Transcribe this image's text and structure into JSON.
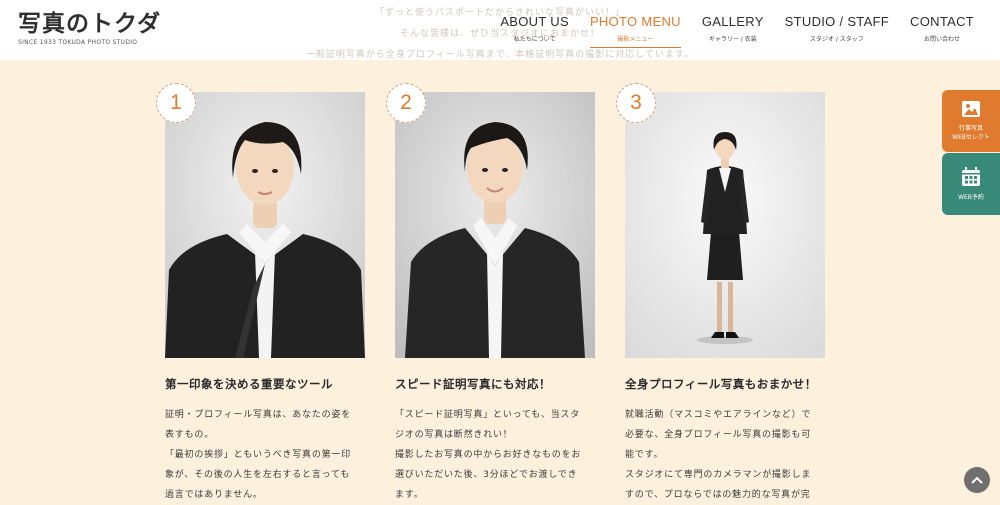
{
  "header": {
    "background_lines": [
      "「ずっと使うパスポートだからきれいな写真がいい！」",
      "そんな皆様は、ぜひ当スタジオにおまかせ！",
      "一般証明写真から全身プロフィール写真まで、本格証明写真の撮影に対応しています。"
    ],
    "logo": {
      "main": "写真のトクダ",
      "sub": "SINCE 1933 TOKUDA PHOTO STUDIO"
    }
  },
  "nav": {
    "items": [
      {
        "en": "ABOUT US",
        "jp": "私たちについて"
      },
      {
        "en": "PHOTO MENU",
        "jp": "撮影メニュー"
      },
      {
        "en": "GALLERY",
        "jp": "ギャラリー / 衣装"
      },
      {
        "en": "STUDIO / STAFF",
        "jp": "スタジオ / スタッフ"
      },
      {
        "en": "CONTACT",
        "jp": "お問い合わせ"
      }
    ],
    "active_index": 1
  },
  "cards": [
    {
      "num": "1",
      "title": "第一印象を決める重要なツール",
      "lines": [
        "証明・プロフィール写真は、あなたの姿を",
        "表すもの。",
        "「最初の挨拶」ともいうべき写真の第一印",
        "象が、その後の人生を左右すると言っても",
        "過言ではありません。"
      ]
    },
    {
      "num": "2",
      "title": "スピード証明写真にも対応！",
      "lines": [
        "「スピード証明写真」といっても、当スタ",
        "ジオの写真は断然きれい！",
        "撮影したお写真の中からお好きなものをお",
        "選びいただいた後、3分ほどでお渡しでき",
        "ます。"
      ]
    },
    {
      "num": "3",
      "title": "全身プロフィール写真もおまかせ！",
      "lines": [
        "就職活動（マスコミやエアラインなど）で",
        "必要な、全身プロフィール写真の撮影も可",
        "能です。",
        "スタジオにて専門のカメラマンが撮影しま",
        "すので、プロならではの魅力的な写真が完"
      ]
    }
  ],
  "side": {
    "orange": {
      "line1": "行事写真",
      "line2": "WEBセレクト",
      "icon": "photo-icon"
    },
    "green": {
      "line1": "WEB予約",
      "icon": "calendar-icon"
    }
  },
  "colors": {
    "accent": "#e07a2e",
    "green": "#3a8a7a",
    "bg": "#fdf0dd"
  }
}
